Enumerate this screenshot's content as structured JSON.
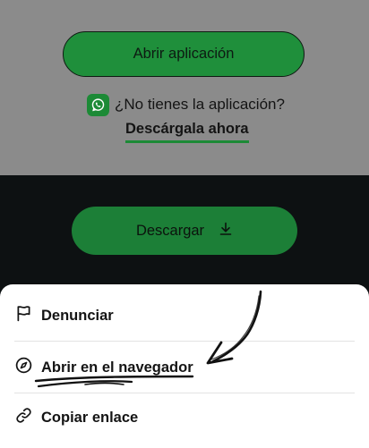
{
  "top": {
    "open_app_label": "Abrir aplicación",
    "no_app_text": "¿No tienes la aplicación?",
    "download_now_label": "Descárgala ahora"
  },
  "download_button": {
    "label": "Descargar"
  },
  "sheet": {
    "items": [
      {
        "label": "Denunciar",
        "icon": "flag-icon"
      },
      {
        "label": "Abrir en el navegador",
        "icon": "compass-icon"
      },
      {
        "label": "Copiar enlace",
        "icon": "link-icon"
      }
    ]
  },
  "colors": {
    "accent_green": "#1c8a36",
    "dim_overlay": "#8b8b8b",
    "dark_band": "#0d1112",
    "sheet_bg": "#ffffff"
  }
}
